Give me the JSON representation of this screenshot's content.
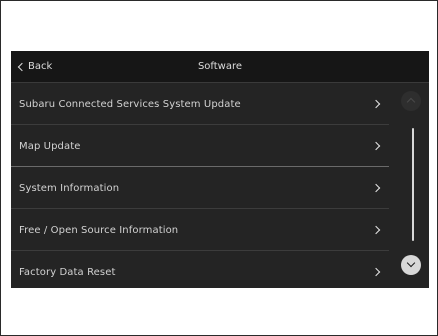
{
  "header": {
    "back_label": "Back",
    "title": "Software"
  },
  "menu": {
    "items": [
      {
        "label": "Subaru Connected Services System Update"
      },
      {
        "label": "Map Update"
      },
      {
        "label": "System Information"
      },
      {
        "label": "Free / Open Source Information"
      },
      {
        "label": "Factory Data Reset"
      }
    ]
  },
  "icons": {
    "back": "chevron-left-icon",
    "item_arrow": "chevron-right-icon",
    "scroll_up": "chevron-up-icon",
    "scroll_down": "chevron-down-icon"
  },
  "colors": {
    "screen_background": "#242424",
    "header_background": "#161616",
    "text": "#d2d2d2",
    "scroll_active": "#d8d8d8"
  }
}
